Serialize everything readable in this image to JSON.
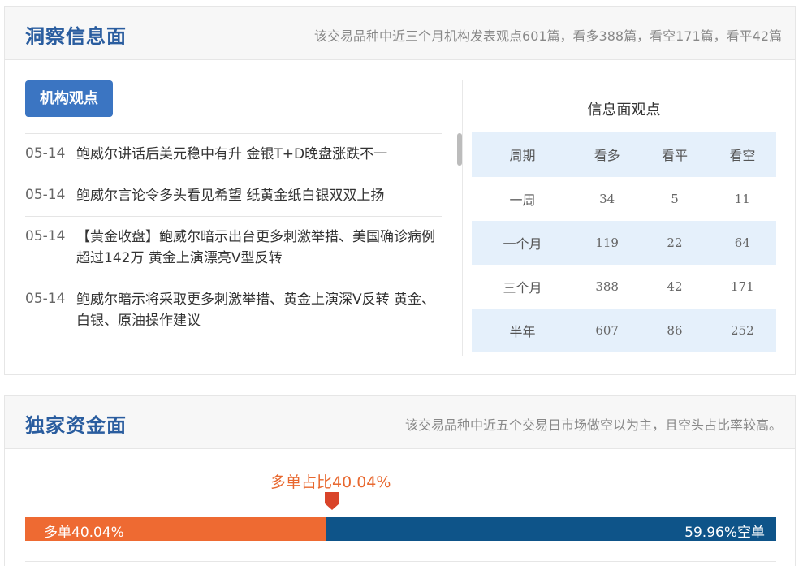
{
  "insight": {
    "title": "洞察信息面",
    "summary": "该交易品种中近三个月机构发表观点601篇，看多388篇，看空171篇，看平42篇",
    "tab_label": "机构观点",
    "news": [
      {
        "date": "05-14",
        "title": "鲍威尔讲话后美元稳中有升 金银T+D晚盘涨跌不一"
      },
      {
        "date": "05-14",
        "title": "鲍威尔言论令多头看见希望 纸黄金纸白银双双上扬"
      },
      {
        "date": "05-14",
        "title": "【黄金收盘】鲍威尔暗示出台更多刺激举措、美国确诊病例超过142万 黄金上演漂亮V型反转"
      },
      {
        "date": "05-14",
        "title": "鲍威尔暗示将采取更多刺激举措、黄金上演深V反转 黄金、白银、原油操作建议"
      }
    ],
    "stats": {
      "title": "信息面观点",
      "headers": [
        "周期",
        "看多",
        "看平",
        "看空"
      ],
      "rows": [
        [
          "一周",
          "34",
          "5",
          "11"
        ],
        [
          "一个月",
          "119",
          "22",
          "64"
        ],
        [
          "三个月",
          "388",
          "42",
          "171"
        ],
        [
          "半年",
          "607",
          "86",
          "252"
        ]
      ]
    }
  },
  "funds": {
    "title": "独家资金面",
    "summary": "该交易品种中近五个交易日市场做空以为主，且空头占比率较高。",
    "long_ratio_label": "多单占比40.04%",
    "long_ratio": 40.04,
    "long_bar_text": "多单40.04%",
    "short_bar_text": "59.96%空单",
    "colors": {
      "long": "#ee6a32",
      "short": "#0e5489",
      "marker": "#d9442a"
    }
  }
}
